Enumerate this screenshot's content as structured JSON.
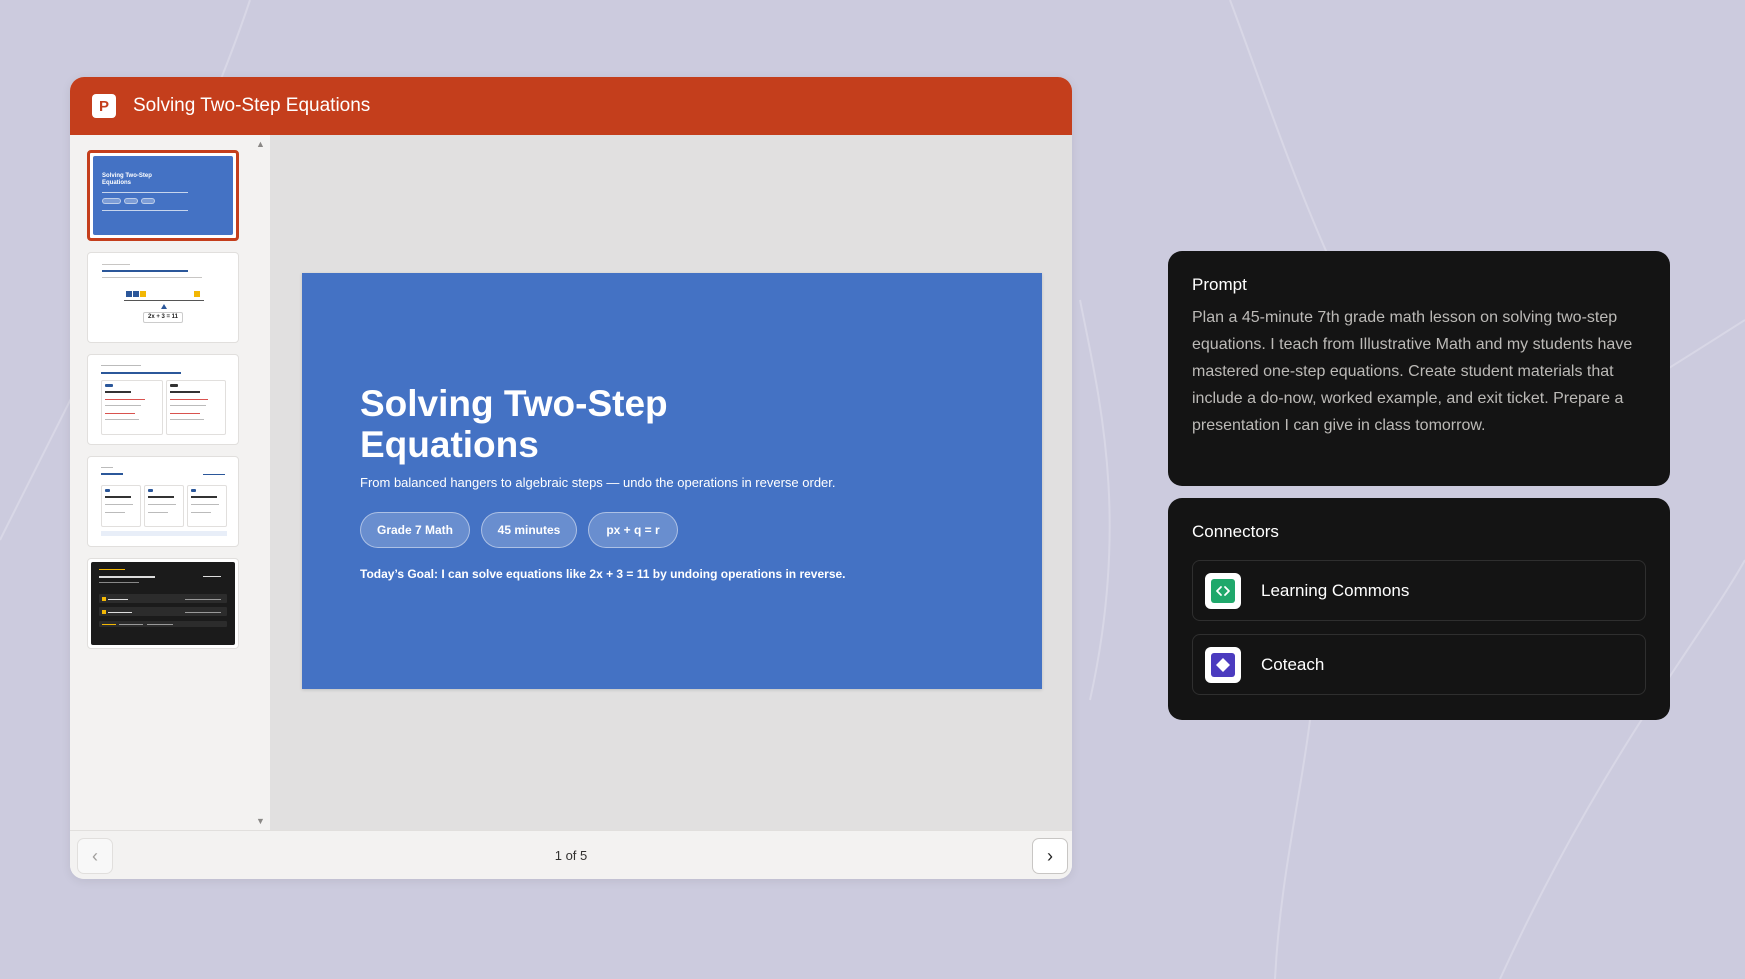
{
  "window": {
    "app_icon_letter": "P",
    "title": "Solving Two-Step Equations"
  },
  "slide": {
    "title": "Solving Two-Step Equations",
    "subtitle": "From balanced hangers to algebraic steps — undo the operations in reverse order.",
    "pills": [
      "Grade 7 Math",
      "45 minutes",
      "px + q = r"
    ],
    "goal": "Today’s Goal: I can solve equations like 2x + 3 = 11 by undoing operations in reverse."
  },
  "thumbnails": {
    "selected_index": 1,
    "count": 5,
    "t1": {
      "title": "Solving Two-Step Equations"
    },
    "t2": {
      "equation": "2x + 3 = 11"
    }
  },
  "footer": {
    "page_count": "1 of 5",
    "prev_icon": "chevron-left-icon",
    "next_icon": "chevron-right-icon"
  },
  "prompt": {
    "heading": "Prompt",
    "text": "Plan a 45-minute 7th grade math lesson on solving two-step equations. I teach from Illustrative Math and my students have mastered one-step equations. Create student materials that include a do-now, worked example, and exit ticket. Prepare a presentation I can give in class tomorrow."
  },
  "connectors": {
    "heading": "Connectors",
    "items": [
      {
        "label": "Learning Commons",
        "icon": "code-brackets-icon",
        "color": "#1fa86b"
      },
      {
        "label": "Coteach",
        "icon": "diamond-icon",
        "color": "#4b3bbf"
      }
    ]
  },
  "colors": {
    "accent": "#c43e1c",
    "slide_bg": "#4472c4",
    "page_bg": "#cccbde"
  }
}
